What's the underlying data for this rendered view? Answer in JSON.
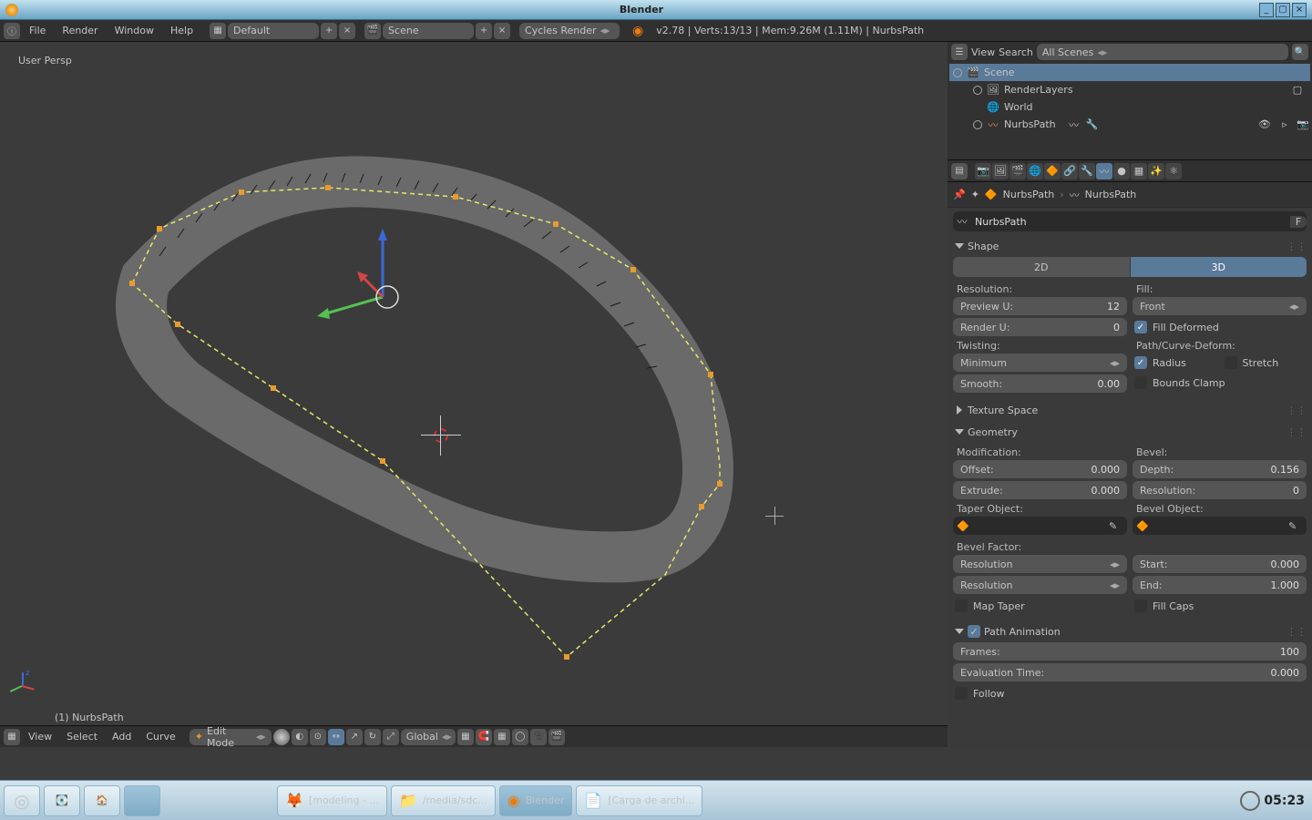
{
  "titlebar": {
    "title": "Blender"
  },
  "header": {
    "menus": {
      "file": "File",
      "render": "Render",
      "window": "Window",
      "help": "Help"
    },
    "layout": "Default",
    "scene": "Scene",
    "engine": "Cycles Render",
    "status": "v2.78 | Verts:13/13 | Mem:9.26M (1.11M) | NurbsPath"
  },
  "viewport": {
    "persp_label": "User Persp",
    "object_label": "(1) NurbsPath",
    "mode": "Edit Mode",
    "global": "Global",
    "menus": {
      "view": "View",
      "select": "Select",
      "add": "Add",
      "curve": "Curve"
    }
  },
  "outliner": {
    "view": "View",
    "search": "Search",
    "scenes_filter": "All Scenes",
    "scene": "Scene",
    "renderlayers": "RenderLayers",
    "world": "World",
    "nurbspath": "NurbsPath"
  },
  "breadcrumb": {
    "obj": "NurbsPath",
    "data": "NurbsPath",
    "name_field": "NurbsPath",
    "f": "F"
  },
  "shape": {
    "title": "Shape",
    "btn2d": "2D",
    "btn3d": "3D",
    "resolution": "Resolution:",
    "preview_u": "Preview U:",
    "preview_u_v": "12",
    "render_u": "Render U:",
    "render_u_v": "0",
    "fill": "Fill:",
    "fill_mode": "Front",
    "fill_deformed": "Fill Deformed",
    "twisting": "Twisting:",
    "twist_mode": "Minimum",
    "smooth": "Smooth:",
    "smooth_v": "0.00",
    "path_deform": "Path/Curve-Deform:",
    "radius": "Radius",
    "stretch": "Stretch",
    "bounds": "Bounds Clamp"
  },
  "texture_space": {
    "title": "Texture Space"
  },
  "geometry": {
    "title": "Geometry",
    "modification": "Modification:",
    "offset": "Offset:",
    "offset_v": "0.000",
    "extrude": "Extrude:",
    "extrude_v": "0.000",
    "bevel": "Bevel:",
    "depth": "Depth:",
    "depth_v": "0.156",
    "bresolution": "Resolution:",
    "bresolution_v": "0",
    "taper_obj": "Taper Object:",
    "bevel_obj": "Bevel Object:",
    "bevel_factor": "Bevel Factor:",
    "bf_mode": "Resolution",
    "start": "Start:",
    "start_v": "0.000",
    "end": "End:",
    "end_v": "1.000",
    "map_taper": "Map Taper",
    "fill_caps": "Fill Caps"
  },
  "path_anim": {
    "title": "Path Animation",
    "frames": "Frames:",
    "frames_v": "100",
    "eval": "Evaluation Time:",
    "eval_v": "0.000",
    "follow": "Follow"
  },
  "taskbar": {
    "firefox": "[modeling - ...",
    "folder": "/media/sdc...",
    "blender": "Blender",
    "writer": "[Carga de archi...",
    "clock": "05:23"
  }
}
